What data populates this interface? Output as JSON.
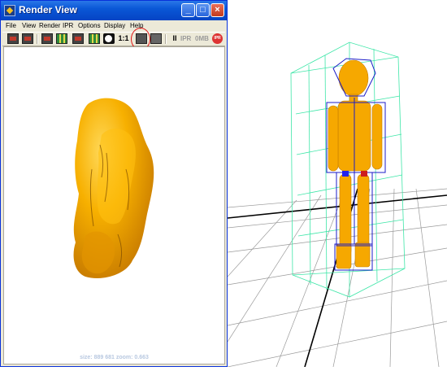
{
  "window": {
    "title": "Render View",
    "controls": {
      "minimize": "_",
      "maximize": "□",
      "close": "×"
    }
  },
  "menu": [
    "File",
    "View",
    "Render",
    "IPR",
    "Options",
    "Display",
    "Help"
  ],
  "toolbar": {
    "ratio_label": "1:1",
    "ipr_label": "IPR",
    "ipr_size_label": "0MB",
    "ipr_badge": "IPR",
    "pause": "II"
  },
  "viewport": {
    "status_text": "size: 889  681 zoom: 0.663"
  },
  "icons": {
    "app": "maya-app-icon",
    "render": "clapperboard-icon",
    "redo_render": "clapperboard-redo-icon",
    "region": "region-render-icon",
    "snapshot": "snapshot-icon",
    "render_settings": "render-settings-icon",
    "rgb": "rgb-channels-icon",
    "alpha": "alpha-channel-icon",
    "keep_image": "keep-image-icon",
    "remove_image": "remove-image-icon"
  },
  "colors": {
    "title_bar": "#0a57d6",
    "window_bg": "#ece9d8",
    "model": "#f6a800",
    "annotation": "#e01414",
    "cage": "#3ee6a8",
    "rig": "#1c1cc8"
  }
}
